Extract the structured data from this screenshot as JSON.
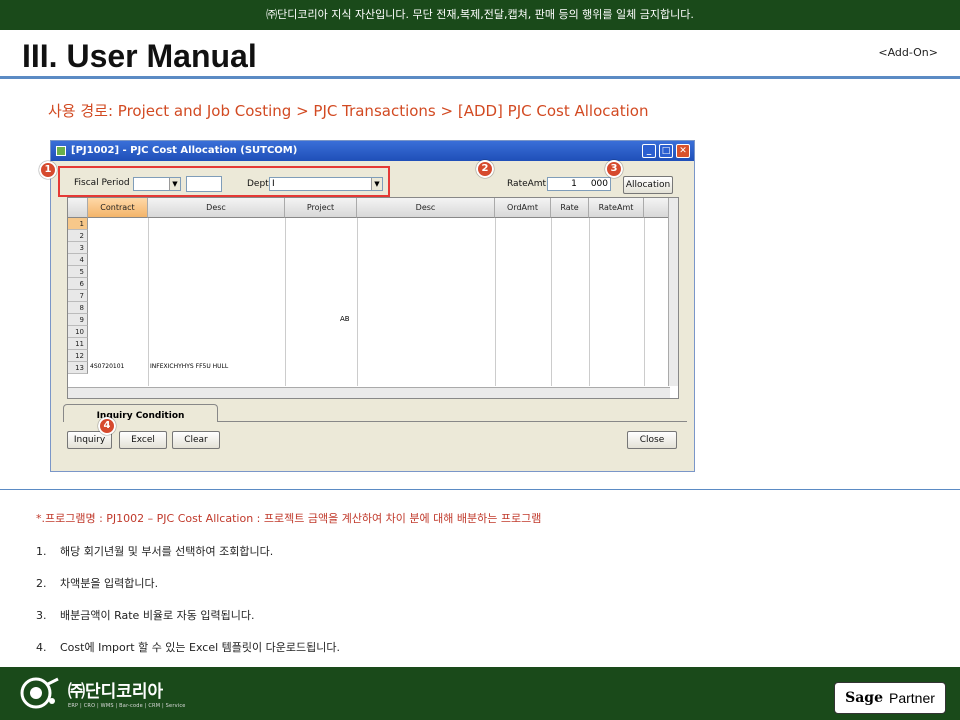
{
  "banner": "㈜단디코리아 지식 자산입니다. 무단 전재,복제,전달,캡쳐, 판매 등의 행위를 일체 금지합니다.",
  "title": "III. User Manual",
  "addon": "<Add-On>",
  "path": "사용 경로: Project and Job Costing > PJC Transactions > [ADD] PJC Cost Allocation",
  "window": {
    "title": "[PJ1002] - PJC Cost Allocation (SUTCOM)",
    "fiscal_label": "Fiscal Period",
    "dept_label": "Dept",
    "dept_value": "I",
    "rateamt_label": "RateAmt",
    "rateamt_value": "1",
    "rateamt_value2": "000",
    "allocation_btn": "Allocation",
    "columns": [
      "Contract",
      "Desc",
      "Project",
      "Desc",
      "OrdAmt",
      "Rate",
      "RateAmt"
    ],
    "rows": [
      "1",
      "2",
      "3",
      "4",
      "5",
      "6",
      "7",
      "8",
      "9",
      "10",
      "11",
      "12",
      "13"
    ],
    "row13": {
      "contract": "4S0720101",
      "desc": "INFEXICHYHYS FF5U HULL"
    },
    "row9_project": "AB",
    "tab_label": "Inquiry Condition",
    "buttons": {
      "inquiry": "Inquiry",
      "excel": "Excel",
      "clear": "Clear",
      "close": "Close"
    }
  },
  "badges": [
    "1",
    "2",
    "3",
    "4"
  ],
  "program": "*.프로그램명 : PJ1002 – PJC Cost Allcation : 프로젝트 금액을 계산하여 차이 분에 대해 배분하는 프로그램",
  "steps": [
    {
      "n": "1.",
      "t": "해당 회기년월 및 부서를 선택하여 조회합니다."
    },
    {
      "n": "2.",
      "t": "차액분을 입력합니다."
    },
    {
      "n": "3.",
      "t": "배분금액이 Rate 비율로 자동 입력됩니다."
    },
    {
      "n": "4.",
      "t": "Cost에 Import 할 수 있는 Excel 템플릿이 다운로드됩니다."
    }
  ],
  "footer": {
    "brand": "㈜단디코리아",
    "sub": "ERP | CRO | WMS | Bar-code | CRM | Service",
    "sage": "Sage",
    "partner": "Partner"
  }
}
